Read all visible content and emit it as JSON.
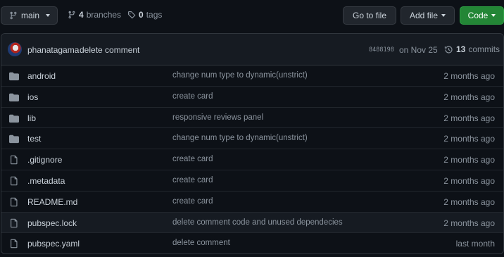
{
  "toolbar": {
    "branch_name": "main",
    "branches_count": "4",
    "branches_label": "branches",
    "tags_count": "0",
    "tags_label": "tags",
    "goto_file_label": "Go to file",
    "add_file_label": "Add file",
    "code_label": "Code"
  },
  "latest_commit": {
    "author": "phanatagama",
    "message": "delete comment",
    "sha": "8488198",
    "date": "on Nov 25",
    "commits_count": "13",
    "commits_label": "commits"
  },
  "files": [
    {
      "type": "dir",
      "icon": "folder-icon",
      "name": "android",
      "message": "change num type to dynamic(unstrict)",
      "age": "2 months ago"
    },
    {
      "type": "dir",
      "icon": "folder-icon",
      "name": "ios",
      "message": "create card",
      "age": "2 months ago"
    },
    {
      "type": "dir",
      "icon": "folder-icon",
      "name": "lib",
      "message": "responsive reviews panel",
      "age": "2 months ago"
    },
    {
      "type": "dir",
      "icon": "folder-icon",
      "name": "test",
      "message": "change num type to dynamic(unstrict)",
      "age": "2 months ago"
    },
    {
      "type": "file",
      "icon": "file-icon",
      "name": ".gitignore",
      "message": "create card",
      "age": "2 months ago"
    },
    {
      "type": "file",
      "icon": "file-icon",
      "name": ".metadata",
      "message": "create card",
      "age": "2 months ago"
    },
    {
      "type": "file",
      "icon": "file-icon",
      "name": "README.md",
      "message": "create card",
      "age": "2 months ago"
    },
    {
      "type": "file",
      "icon": "file-icon",
      "name": "pubspec.lock",
      "message": "delete comment code and unused dependecies",
      "age": "2 months ago"
    },
    {
      "type": "file",
      "icon": "file-icon",
      "name": "pubspec.yaml",
      "message": "delete comment",
      "age": "last month"
    }
  ],
  "colors": {
    "background": "#0d1117",
    "panel": "#161b22",
    "border": "#30363d",
    "text": "#c9d1d9",
    "muted": "#8b949e",
    "code_button": "#238636",
    "folder": "#8b949e"
  }
}
